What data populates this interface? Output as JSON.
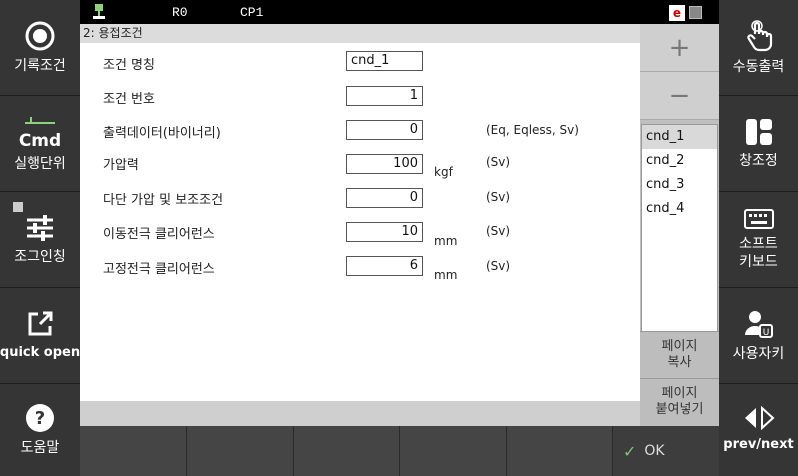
{
  "left_sidebar": {
    "items": [
      {
        "label": "기록조건",
        "icon": "record-icon"
      },
      {
        "label": "실행단위",
        "icon": "cmd-icon",
        "cmd_text": "Cmd"
      },
      {
        "label": "조그인칭",
        "icon": "sliders-icon"
      },
      {
        "label": "quick open",
        "icon": "external-link-icon"
      },
      {
        "label": "도움말",
        "icon": "help-icon"
      }
    ]
  },
  "right_sidebar": {
    "items": [
      {
        "label": "수동출력",
        "icon": "hand-pointer-icon"
      },
      {
        "label": "창조정",
        "icon": "window-layout-icon"
      },
      {
        "label": "소프트\n키보드",
        "icon": "keyboard-icon"
      },
      {
        "label": "사용자키",
        "icon": "user-key-icon"
      },
      {
        "label": "prev/next",
        "icon": "prev-next-icon"
      }
    ]
  },
  "status_bar": {
    "robot": "R0",
    "cp": "CP1",
    "e_badge": "e"
  },
  "panel": {
    "title": "2: 용접조건"
  },
  "form": {
    "rows": [
      {
        "label": "조건 명칭",
        "value": "cnd_1",
        "unit": "",
        "note": ""
      },
      {
        "label": "조건 번호",
        "value": "1",
        "unit": "",
        "note": ""
      },
      {
        "label": "출력데이터(바이너리)",
        "value": "0",
        "unit": "",
        "note": "(Eq, Eqless, Sv)"
      },
      {
        "label": "가압력",
        "value": "100",
        "unit": "kgf",
        "note": "(Sv)"
      },
      {
        "label": "다단 가압 및 보조조건",
        "value": "0",
        "unit": "",
        "note": "(Sv)"
      },
      {
        "label": "이동전극 클리어런스",
        "value": "10",
        "unit": "mm",
        "note": "(Sv)"
      },
      {
        "label": "고정전극 클리어런스",
        "value": "6",
        "unit": "mm",
        "note": "(Sv)"
      }
    ]
  },
  "right_panel": {
    "plus": "+",
    "minus": "−",
    "conditions": [
      "cnd_1",
      "cnd_2",
      "cnd_3",
      "cnd_4"
    ],
    "selected": "cnd_1",
    "copy_page": "페이지\n복사",
    "paste_page": "페이지\n붙여넣기"
  },
  "bottom_bar": {
    "ok": "OK"
  }
}
